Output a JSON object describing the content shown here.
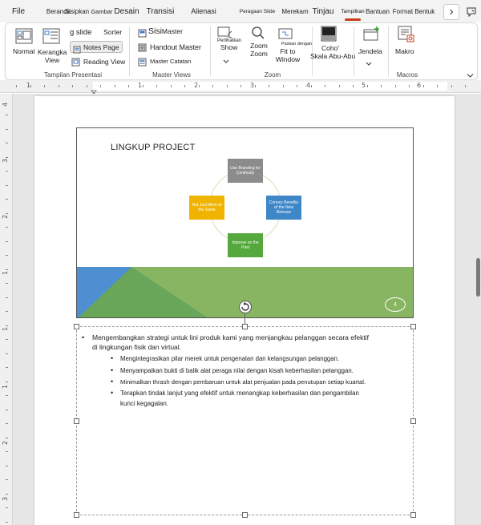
{
  "tabs": [
    {
      "label": "File",
      "active": false
    },
    {
      "label": "Beranda",
      "active": false
    },
    {
      "label": "Sisipkan",
      "active": false
    },
    {
      "label": "Gambar",
      "active": false
    },
    {
      "label": "Desain",
      "active": false
    },
    {
      "label": "Transisi",
      "active": false
    },
    {
      "label": "Alienasi",
      "active": false
    },
    {
      "label": "Peragaan Slide",
      "active": false
    },
    {
      "label": "Merekam",
      "active": false
    },
    {
      "label": "Tinjau",
      "active": false
    },
    {
      "label": "Tampilkan",
      "active": true
    },
    {
      "label": "Bantuan",
      "active": false
    },
    {
      "label": "Format Bentuk",
      "active": false
    }
  ],
  "tab_more_icon": "chevron-right-icon",
  "feedback_icon": "feedback-icon",
  "ribbon": {
    "presentation_views": {
      "group_label": "Tampilan Presentasi",
      "normal": "Normal",
      "outline_line1": "Kerangka",
      "outline_line2": "View",
      "slide_sorter_part1": "g slide",
      "slide_sorter_part2": "Sorter",
      "notes_page": "Notes Page",
      "reading_view": "Reading View"
    },
    "master_views": {
      "group_label": "Master Views",
      "slide_master_part1": "Sisi",
      "slide_master_part2": "Master",
      "handout_master": "Handout Master",
      "notes_master": "Master Catatan"
    },
    "zoom": {
      "group_label": "Zoom",
      "show_top": "Perlihatkan",
      "show": "Show",
      "zoom_line1": "Zoom",
      "zoom_line2": "Zoom",
      "fit_top": "Paskan dengan",
      "fit_line1": "Fit to",
      "fit_line2": "Window"
    },
    "color": {
      "line1": "Coho'",
      "line2": "Skala Abu-Abu"
    },
    "window": {
      "label": "Jendela"
    },
    "macros": {
      "group_label": "Macros",
      "label": "Makro"
    },
    "collapse_icon": "chevron-down-icon"
  },
  "ruler": {
    "numbers": [
      "1",
      "1",
      "2",
      "3",
      "4",
      "5",
      "6"
    ],
    "vertical_numbers": [
      "4",
      "3",
      "2",
      "1",
      "1",
      "1",
      "2",
      "3"
    ]
  },
  "slide": {
    "title": "LINGKUP PROJECT",
    "boxes": [
      {
        "text": "Use Branding for Continuity",
        "color": "#8c8c8c"
      },
      {
        "text": "Convey Benefits of the New Release",
        "color": "#3d86c8"
      },
      {
        "text": "Improve on the Past",
        "color": "#55a83c"
      },
      {
        "text": "Not Just More of the Same",
        "color": "#f0b400"
      }
    ],
    "number": "4",
    "colors": {
      "green": "#88b562",
      "dark_green": "#6aa65a",
      "blue": "#4d8fd0"
    }
  },
  "notes": {
    "main_bullet_line1": "Mengembangkan strategi untuk lini produk kami yang menjangkau pelanggan secara efektif",
    "main_bullet_line2": "di lingkungan fisik dan virtual.",
    "sub_bullets": [
      {
        "line1": "Mengintegrasikan pilar merek untuk pengenalan dan kelangsungan pelanggan.",
        "line2": ""
      },
      {
        "line1": "Menyampaikan bukti di balik alat peraga nilai dengan kisah keberhasilan pelanggan.",
        "line2": ""
      },
      {
        "line1": "Minimalkan thrash dengan pembaruan untuk alat penjualan pada penutupan setiap kuartal.",
        "line2": ""
      },
      {
        "line1": "Terapkan tindak lanjut yang efektif untuk menangkap keberhasilan dan pengambilan",
        "line2": "kunci kegagalan."
      }
    ]
  }
}
